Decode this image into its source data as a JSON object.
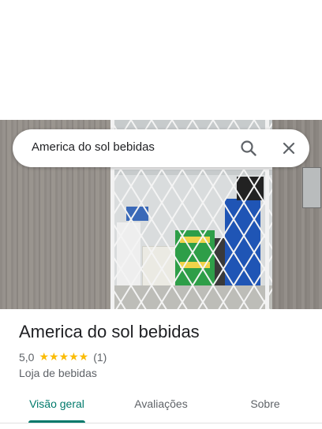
{
  "search": {
    "query": "America do sol bebidas"
  },
  "place": {
    "name": "America do sol bebidas",
    "rating": "5,0",
    "stars": "★★★★★",
    "review_count": "(1)",
    "category": "Loja de bebidas"
  },
  "tabs": [
    {
      "label": "Visão geral"
    },
    {
      "label": "Avaliações"
    },
    {
      "label": "Sobre"
    }
  ],
  "colors": {
    "accent": "#00796b",
    "star": "#fbbc04"
  }
}
